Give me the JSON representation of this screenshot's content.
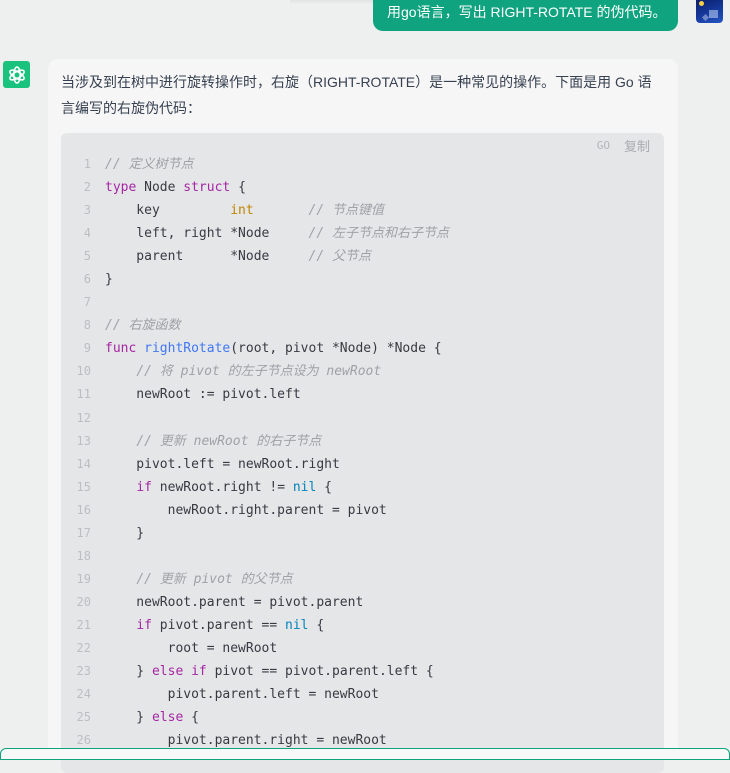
{
  "user_message": {
    "text": "用go语言，写出 RIGHT-ROTATE 的伪代码。",
    "avatar": "user-avatar-night-scene",
    "bubble_color": "#10a37f"
  },
  "assistant_message": {
    "avatar": "chatgpt-logo-icon",
    "avatar_color": "#19c37d",
    "intro": "当涉及到在树中进行旋转操作时，右旋（RIGHT-ROTATE）是一种常见的操作。下面是用 Go 语言编写的右旋伪代码：",
    "code_block": {
      "language": "GO",
      "copy_label": "复制",
      "lines": [
        [
          {
            "t": "cm",
            "v": "// 定义树节点"
          }
        ],
        [
          {
            "t": "kw",
            "v": "type"
          },
          {
            "t": "src",
            "v": " Node "
          },
          {
            "t": "kw",
            "v": "struct"
          },
          {
            "t": "src",
            "v": " {"
          }
        ],
        [
          {
            "t": "src",
            "v": "    key         "
          },
          {
            "t": "ty",
            "v": "int"
          },
          {
            "t": "src",
            "v": "       "
          },
          {
            "t": "cm",
            "v": "// 节点键值"
          }
        ],
        [
          {
            "t": "src",
            "v": "    left, right *Node     "
          },
          {
            "t": "cm",
            "v": "// 左子节点和右子节点"
          }
        ],
        [
          {
            "t": "src",
            "v": "    parent      *Node     "
          },
          {
            "t": "cm",
            "v": "// 父节点"
          }
        ],
        [
          {
            "t": "src",
            "v": "}"
          }
        ],
        [
          {
            "t": "src",
            "v": ""
          }
        ],
        [
          {
            "t": "cm",
            "v": "// 右旋函数"
          }
        ],
        [
          {
            "t": "kw",
            "v": "func"
          },
          {
            "t": "src",
            "v": " "
          },
          {
            "t": "fn",
            "v": "rightRotate"
          },
          {
            "t": "src",
            "v": "(root, pivot *Node) *Node {"
          }
        ],
        [
          {
            "t": "src",
            "v": "    "
          },
          {
            "t": "cm",
            "v": "// 将 pivot 的左子节点设为 newRoot"
          }
        ],
        [
          {
            "t": "src",
            "v": "    newRoot := pivot.left"
          }
        ],
        [
          {
            "t": "src",
            "v": ""
          }
        ],
        [
          {
            "t": "src",
            "v": "    "
          },
          {
            "t": "cm",
            "v": "// 更新 newRoot 的右子节点"
          }
        ],
        [
          {
            "t": "src",
            "v": "    pivot.left = newRoot.right"
          }
        ],
        [
          {
            "t": "src",
            "v": "    "
          },
          {
            "t": "kw",
            "v": "if"
          },
          {
            "t": "src",
            "v": " newRoot.right != "
          },
          {
            "t": "nl",
            "v": "nil"
          },
          {
            "t": "src",
            "v": " {"
          }
        ],
        [
          {
            "t": "src",
            "v": "        newRoot.right.parent = pivot"
          }
        ],
        [
          {
            "t": "src",
            "v": "    }"
          }
        ],
        [
          {
            "t": "src",
            "v": ""
          }
        ],
        [
          {
            "t": "src",
            "v": "    "
          },
          {
            "t": "cm",
            "v": "// 更新 pivot 的父节点"
          }
        ],
        [
          {
            "t": "src",
            "v": "    newRoot.parent = pivot.parent"
          }
        ],
        [
          {
            "t": "src",
            "v": "    "
          },
          {
            "t": "kw",
            "v": "if"
          },
          {
            "t": "src",
            "v": " pivot.parent == "
          },
          {
            "t": "nl",
            "v": "nil"
          },
          {
            "t": "src",
            "v": " {"
          }
        ],
        [
          {
            "t": "src",
            "v": "        root = newRoot"
          }
        ],
        [
          {
            "t": "src",
            "v": "    } "
          },
          {
            "t": "kw",
            "v": "else if"
          },
          {
            "t": "src",
            "v": " pivot == pivot.parent.left {"
          }
        ],
        [
          {
            "t": "src",
            "v": "        pivot.parent.left = newRoot"
          }
        ],
        [
          {
            "t": "src",
            "v": "    } "
          },
          {
            "t": "kw",
            "v": "else"
          },
          {
            "t": "src",
            "v": " {"
          }
        ],
        [
          {
            "t": "src",
            "v": "        pivot.parent.right = newRoot"
          }
        ]
      ]
    }
  }
}
